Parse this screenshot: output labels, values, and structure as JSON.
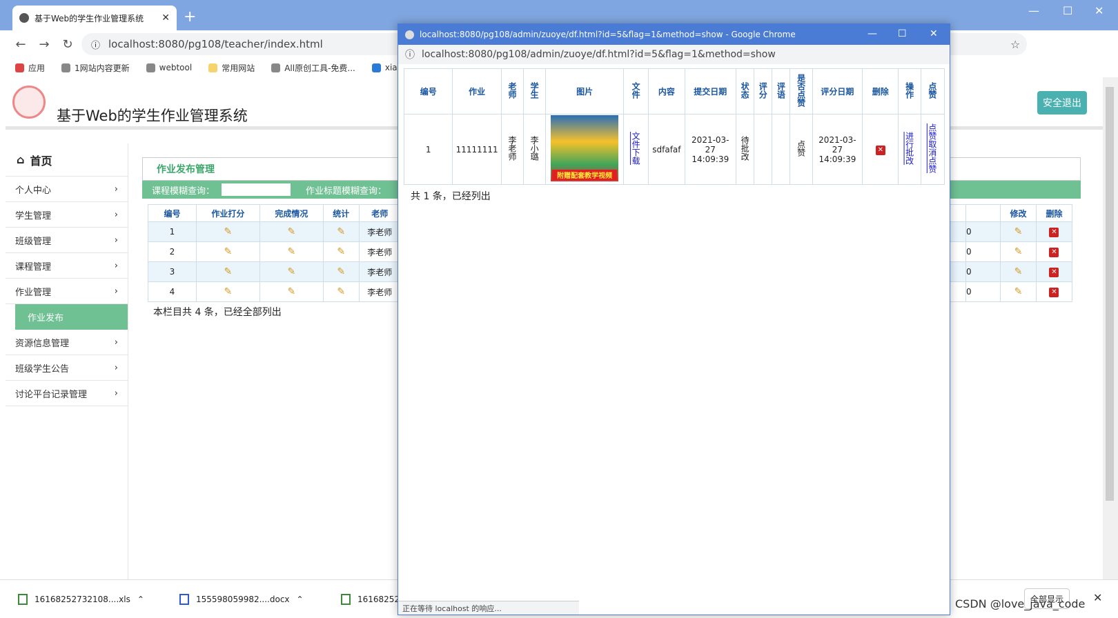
{
  "browser": {
    "tab_title": "基于Web的学生作业管理系统",
    "url": "localhost:8080/pg108/teacher/index.html",
    "bookmarks": [
      "应用",
      "1网站内容更新",
      "webtool",
      "常用网站",
      "All原创工具-免费...",
      "xia"
    ]
  },
  "page": {
    "site_title": "基于Web的学生作业管理系统",
    "logout_label": "安全退出",
    "home_label": "首页",
    "menu": [
      "个人中心",
      "学生管理",
      "班级管理",
      "课程管理",
      "作业管理",
      "资源信息管理",
      "班级学生公告",
      "讨论平台记录管理"
    ],
    "submenu_active": "作业发布",
    "panel_title": "作业发布管理",
    "search": {
      "course_label": "课程模糊查询：",
      "title_label": "作业标题模糊查询："
    },
    "table": {
      "headers": [
        "编号",
        "作业打分",
        "完成情况",
        "统计",
        "老师"
      ],
      "right_headers": [
        "修改",
        "删除"
      ],
      "rows": [
        {
          "id": "1",
          "teacher": "李老师",
          "tail": "0"
        },
        {
          "id": "2",
          "teacher": "李老师",
          "tail": "0"
        },
        {
          "id": "3",
          "teacher": "李老师",
          "tail": "0"
        },
        {
          "id": "4",
          "teacher": "李老师",
          "tail": "0"
        }
      ]
    },
    "total_text": "本栏目共 4 条，已经全部列出"
  },
  "popup": {
    "title": "localhost:8080/pg108/admin/zuoye/df.html?id=5&flag=1&method=show - Google Chrome",
    "url": "localhost:8080/pg108/admin/zuoye/df.html?id=5&flag=1&method=show",
    "headers": {
      "h0": "编号",
      "h1": "作业",
      "h2": "老师",
      "h3": "学生",
      "h4": "图片",
      "h5": "文件",
      "h6": "内容",
      "h7": "提交日期",
      "h8": "状态",
      "h9": "评分",
      "h10": "评语",
      "h11": "是否点赞",
      "h12": "评分日期",
      "h13": "删除",
      "h14": "操作",
      "h15": "点赞"
    },
    "row": {
      "id": "1",
      "zuoye": "11111111",
      "teacher": "李老师",
      "student": "李小璐",
      "image_caption": "附赠配套教学视频",
      "file_link": "文件下载",
      "content": "sdfafaf",
      "submit_date": "2021-03-27 14:09:39",
      "status": "待批改",
      "score": "",
      "comment": "",
      "liked": "点赞",
      "score_date": "2021-03-27 14:09:39",
      "action_link": "进行批改",
      "like_link": "点赞取消点赞"
    },
    "total_text": "共 1 条，已经列出",
    "status_bar": "正在等待 localhost 的响应..."
  },
  "downloads": {
    "items": [
      "16168252732108....xls",
      "155598059982....docx",
      "161682527"
    ],
    "show_all": "全部显示"
  },
  "watermark": "CSDN @love_java_code"
}
